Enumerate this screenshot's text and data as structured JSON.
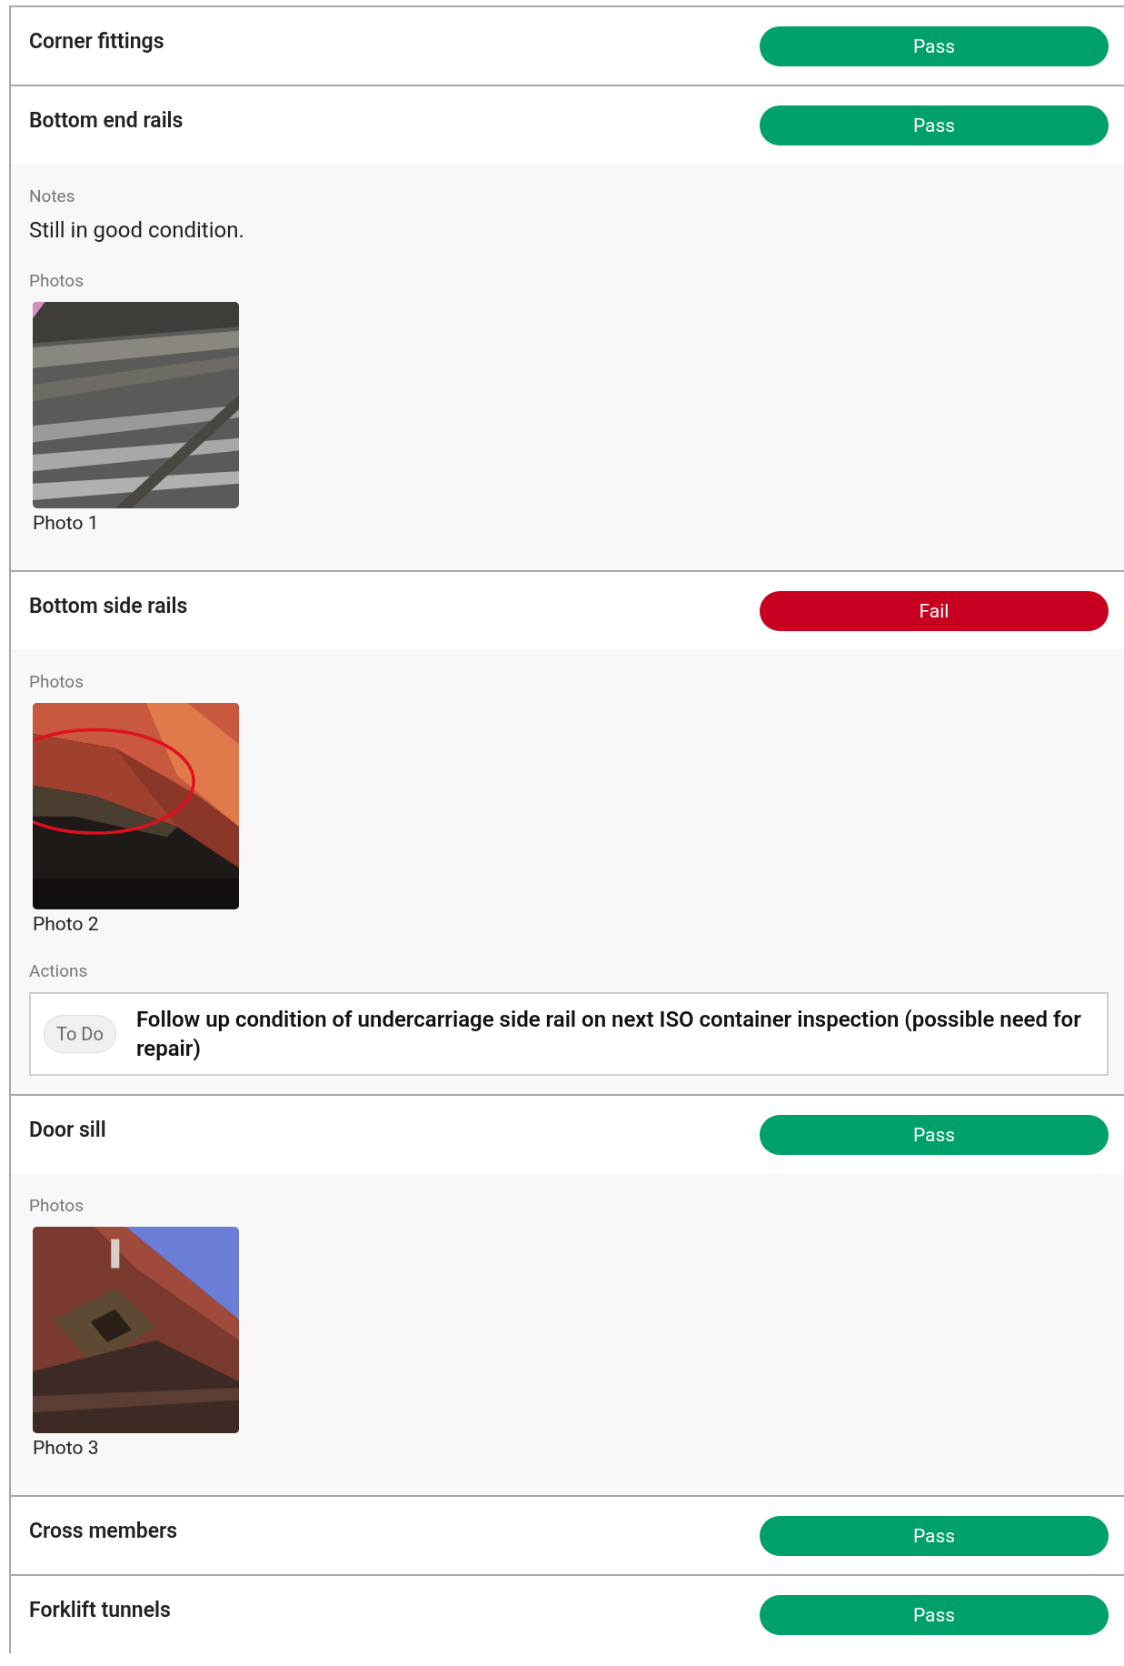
{
  "items": [
    {
      "name": "Corner fittings",
      "result": {
        "label": "Pass",
        "kind": "pass"
      }
    },
    {
      "name": "Bottom end rails",
      "result": {
        "label": "Pass",
        "kind": "pass"
      },
      "details": {
        "notes_label": "Notes",
        "notes": "Still in good condition.",
        "photos_label": "Photos",
        "photos": [
          {
            "caption": "Photo 1",
            "kind": "picture"
          }
        ]
      }
    },
    {
      "name": "Bottom side rails",
      "result": {
        "label": "Fail",
        "kind": "fail"
      },
      "details": {
        "photos_label": "Photos",
        "photos": [
          {
            "caption": "Photo 2",
            "kind": "picture"
          }
        ],
        "actions_label": "Actions",
        "actions": [
          {
            "status": "To Do",
            "text": "Follow up condition of undercarriage side rail on next ISO container inspection (possible need for repair)"
          }
        ]
      }
    },
    {
      "name": "Door sill",
      "result": {
        "label": "Pass",
        "kind": "pass"
      },
      "details": {
        "photos_label": "Photos",
        "photos": [
          {
            "caption": "Photo 3",
            "kind": "picture"
          }
        ]
      }
    },
    {
      "name": "Cross members",
      "result": {
        "label": "Pass",
        "kind": "pass"
      }
    },
    {
      "name": "Forklift tunnels",
      "result": {
        "label": "Pass",
        "kind": "pass"
      }
    }
  ]
}
